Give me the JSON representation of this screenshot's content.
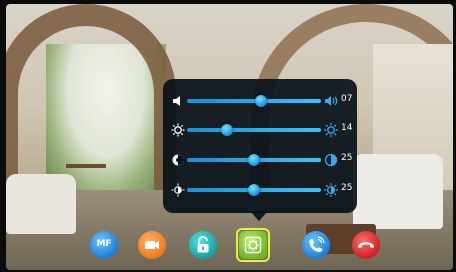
{
  "settings_panel": {
    "rows": [
      {
        "name": "volume",
        "value": "07",
        "level": 0.55,
        "left_icon": "volume-low-icon",
        "right_icon": "volume-high-icon"
      },
      {
        "name": "brightness",
        "value": "14",
        "level": 0.3,
        "left_icon": "brightness-low-icon",
        "right_icon": "brightness-high-icon"
      },
      {
        "name": "contrast",
        "value": "25",
        "level": 0.5,
        "left_icon": "contrast-low-icon",
        "right_icon": "contrast-high-icon"
      },
      {
        "name": "color",
        "value": "25",
        "level": 0.5,
        "left_icon": "color-low-icon",
        "right_icon": "color-high-icon"
      }
    ]
  },
  "bottom_bar": {
    "buttons": [
      {
        "name": "mf-button",
        "label": "MF",
        "icon": "mf-icon"
      },
      {
        "name": "video-button",
        "icon": "video-camera-icon"
      },
      {
        "name": "unlock-button",
        "icon": "unlock-icon"
      },
      {
        "name": "settings-button",
        "icon": "gear-icon",
        "selected": true
      },
      {
        "name": "call-button",
        "icon": "phone-icon"
      },
      {
        "name": "hangup-button",
        "icon": "hangup-icon"
      }
    ]
  },
  "colors": {
    "slider_accent": "#1b8ed8",
    "panel_bg": "#08101a",
    "selected_ring": "#e8f03a"
  }
}
